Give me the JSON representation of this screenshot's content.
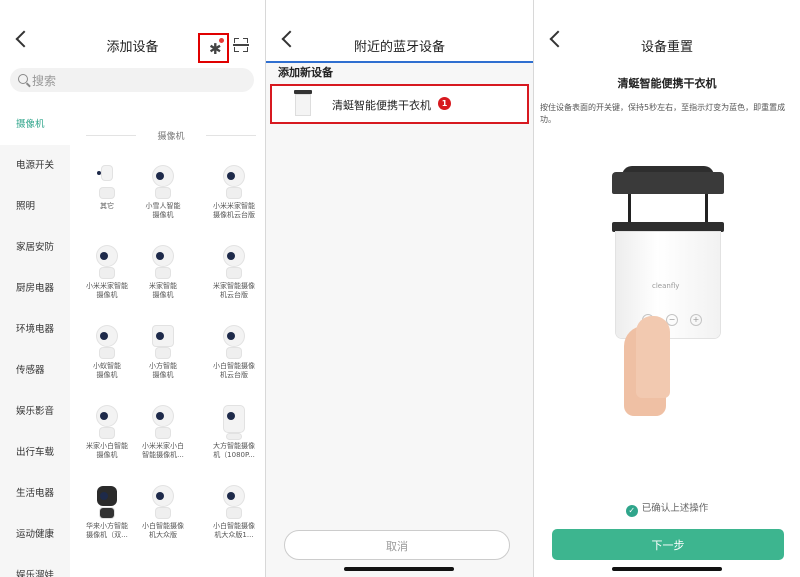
{
  "panel1": {
    "title": "添加设备",
    "search_placeholder": "搜索",
    "section_title": "摄像机",
    "categories": [
      "摄像机",
      "电源开关",
      "照明",
      "家居安防",
      "厨房电器",
      "环境电器",
      "传感器",
      "娱乐影音",
      "出行车载",
      "生活电器",
      "运动健康",
      "娱乐溜娃"
    ],
    "active_category_index": 0,
    "devices": [
      {
        "label": "其它",
        "style": "thin"
      },
      {
        "label": "小雪人智能\n摄像机",
        "style": "round"
      },
      {
        "label": "小米米家智能\n摄像机云台版",
        "style": "round"
      },
      {
        "label": "小米米家智能\n摄像机",
        "style": "round"
      },
      {
        "label": "米家智能\n摄像机",
        "style": "round"
      },
      {
        "label": "米家智能摄像\n机云台版",
        "style": "round"
      },
      {
        "label": "小蚁智能\n摄像机",
        "style": "round"
      },
      {
        "label": "小方智能\n摄像机",
        "style": "box"
      },
      {
        "label": "小白智能摄像\n机云台版",
        "style": "round"
      },
      {
        "label": "米家小白智能\n摄像机",
        "style": "round"
      },
      {
        "label": "小米米家小白\n智能摄像机...",
        "style": "round"
      },
      {
        "label": "大方智能摄像\n机（1080P...",
        "style": "tall"
      },
      {
        "label": "华来小方智能\n摄像机（双...",
        "style": "dark"
      },
      {
        "label": "小白智能摄像\n机大众版",
        "style": "round"
      },
      {
        "label": "小白智能摄像\n机大众版1...",
        "style": "round"
      }
    ]
  },
  "panel2": {
    "title": "附近的蓝牙设备",
    "section_label": "添加新设备",
    "device_name": "清蜓智能便携干衣机",
    "badge": "1",
    "bottom_button": "取消"
  },
  "panel3": {
    "title": "设备重置",
    "device_title": "清蜓智能便携干衣机",
    "instructions": "按住设备表面的开关键，保持5秒左右，至指示灯变为蓝色，即重置成功。",
    "brand_text": "cleanfly",
    "minus": "−",
    "plus": "+",
    "confirm_text": "已确认上述操作",
    "next_button": "下一步"
  },
  "colors": {
    "accent": "#3db58f",
    "highlight": "#d71920",
    "active_tab_underline": "#2f6fd0"
  }
}
